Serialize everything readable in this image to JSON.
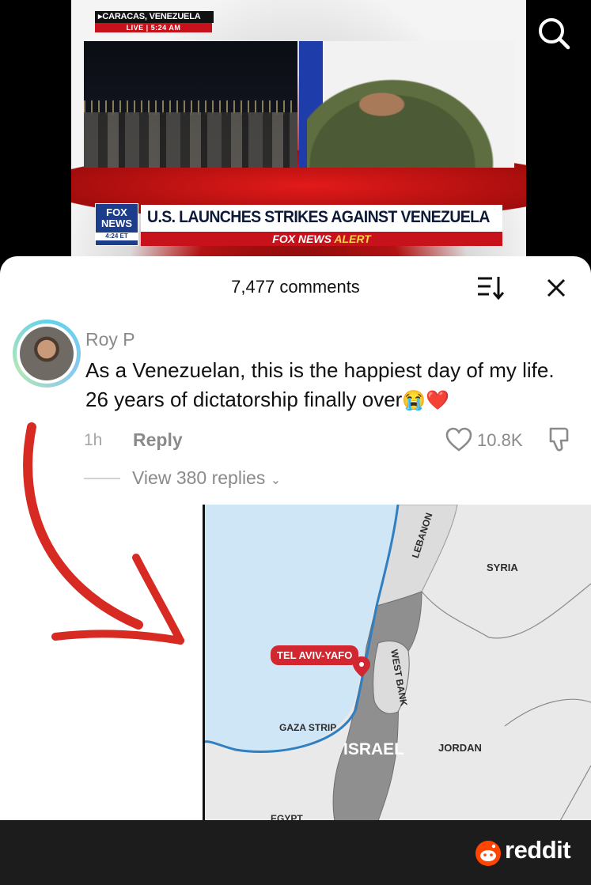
{
  "video": {
    "location": "CARACAS, VENEZUELA",
    "live_label": "LIVE",
    "live_time": "5:24 AM",
    "network_logo_top": "FOX",
    "network_logo_bottom": "NEWS",
    "network_time": "4:24 ET",
    "headline": "U.S. LAUNCHES STRIKES AGAINST VENEZUELA",
    "alert_brand": "FOX NEWS",
    "alert_word": "ALERT",
    "search_icon": "search-icon"
  },
  "comments": {
    "count_label": "7,477 comments",
    "sort_icon": "sort-icon",
    "close_icon": "close-icon",
    "comment": {
      "username": "Roy P",
      "text": "As a Venezuelan, this is the happiest day of my life. 26 years of dictatorship finally over",
      "emojis": "😭❤️",
      "time": "1h",
      "reply_label": "Reply",
      "likes": "10.8K",
      "view_replies": "View 380 replies"
    }
  },
  "map": {
    "labels": {
      "lebanon": "LEBANON",
      "syria": "SYRIA",
      "tel_aviv": "TEL AVIV-YAFO",
      "west_bank": "WEST BANK",
      "gaza": "GAZA STRIP",
      "israel": "ISRAEL",
      "jordan": "JORDAN",
      "egypt": "EGYPT"
    },
    "colors": {
      "sea": "#cfe6f7",
      "coast": "#2f7fc1",
      "israel": "#8f8f8f",
      "neighbors": "#e6e6e6",
      "pin": "#d22630"
    }
  },
  "footer": {
    "brand": "reddit"
  }
}
